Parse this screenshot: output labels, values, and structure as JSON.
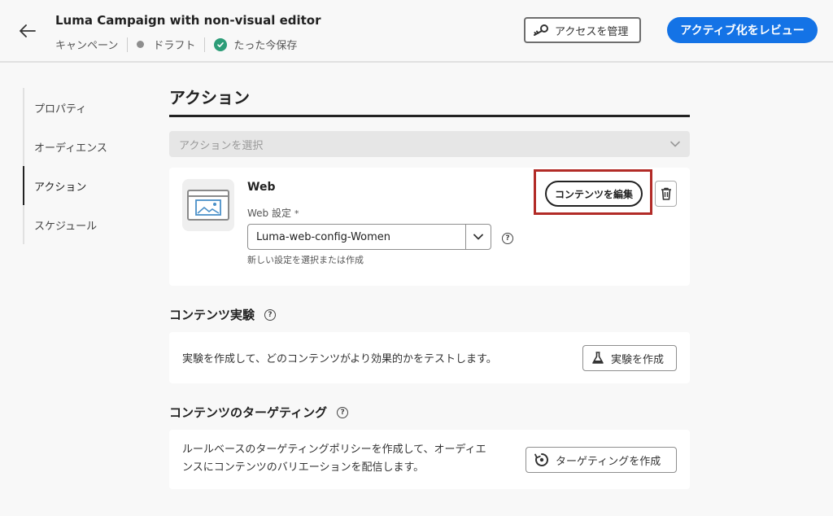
{
  "header": {
    "title": "Luma Campaign with non-visual editor",
    "breadcrumb_type": "キャンペーン",
    "status": "ドラフト",
    "save_status": "たった今保存",
    "manage_access_label": "アクセスを管理",
    "review_activate_label": "アクティブ化をレビュー"
  },
  "sidenav": {
    "items": [
      {
        "label": "プロパティ"
      },
      {
        "label": "オーディエンス"
      },
      {
        "label": "アクション"
      },
      {
        "label": "スケジュール"
      }
    ],
    "active": "アクション"
  },
  "main": {
    "section_title": "アクション",
    "action_select_placeholder": "アクションを選択",
    "web_card": {
      "title": "Web",
      "setting_label": "Web 設定",
      "required_mark": "*",
      "config_value": "Luma-web-config-Women",
      "hint": "新しい設定を選択または作成",
      "edit_content_label": "コンテンツを編集"
    },
    "experiment": {
      "title": "コンテンツ実験",
      "description": "実験を作成して、どのコンテンツがより効果的かをテストします。",
      "button_label": "実験を作成"
    },
    "targeting": {
      "title": "コンテンツのターゲティング",
      "description": "ルールベースのターゲティングポリシーを作成して、オーディエンスにコンテンツのバリエーションを配信します。",
      "button_label": "ターゲティングを作成"
    }
  },
  "colors": {
    "accent": "#1473e6",
    "highlight": "#b22b27",
    "success": "#2d9d78"
  }
}
